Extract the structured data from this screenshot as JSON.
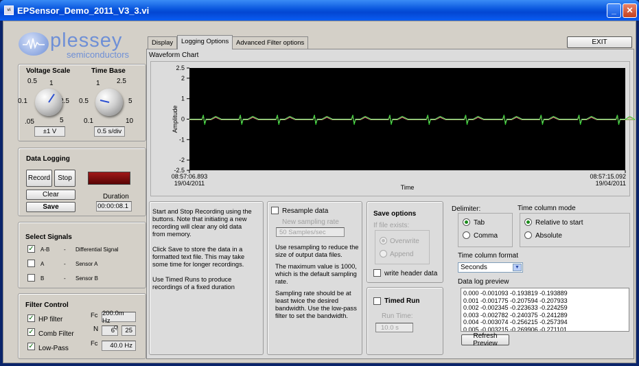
{
  "window": {
    "title": "EPSensor_Demo_2011_V3_3.vi",
    "min": "_",
    "max": "□",
    "close": "✕"
  },
  "logo": {
    "name": "plessey",
    "sub": "semiconductors"
  },
  "voltage": {
    "title": "Voltage Scale",
    "t1": "0.5",
    "t2": "1",
    "l1": "0.1",
    "r1": "2.5",
    "l2": ".05",
    "r2": "5",
    "value": "±1 V"
  },
  "time": {
    "title": "Time Base",
    "t1": "1",
    "t2": "2.5",
    "l1": "0.5",
    "r1": "5",
    "l2": "0.1",
    "r2": "10",
    "value": "0.5 s/div"
  },
  "logging": {
    "title": "Data Logging",
    "record": "Record",
    "stop": "Stop",
    "clear": "Clear",
    "save": "Save",
    "duration_label": "Duration",
    "duration": "00:00:08.1",
    "led_color": "#7a0a0a"
  },
  "signals": {
    "title": "Select Signals",
    "items": [
      {
        "code": "A-B",
        "dash": "-",
        "desc": "Differential Signal",
        "checked": "✓"
      },
      {
        "code": "A",
        "dash": "-",
        "desc": "Sensor A",
        "checked": ""
      },
      {
        "code": "B",
        "dash": "-",
        "desc": "Sensor B",
        "checked": ""
      }
    ]
  },
  "filter": {
    "title": "Filter Control",
    "hp": "HP filter",
    "hp_fc_label": "Fc",
    "hp_fc": "200.0m Hz",
    "comb": "Comb Filter",
    "n_label": "N",
    "n": "6",
    "q_label": "Q",
    "q": "25",
    "lp": "Low-Pass",
    "lp_fc_label": "Fc",
    "lp_fc": "40.0 Hz"
  },
  "tabs": [
    "Display",
    "Logging Options",
    "Advanced Filter options"
  ],
  "exit": "EXIT",
  "chart": {
    "title": "Waveform Chart",
    "ylabel": "Amplitude",
    "xlabel": "Time",
    "yticks": [
      "2.5",
      "2",
      "1",
      "0",
      "-1",
      "-2",
      "-2.5"
    ],
    "x_start_time": "08:57:06.893",
    "x_start_date": "19/04/2011",
    "x_end_time": "08:57:15.092",
    "x_end_date": "19/04/2011",
    "beats": [
      0.035,
      0.12,
      0.205,
      0.29,
      0.378,
      0.463,
      0.55,
      0.637,
      0.725,
      0.81,
      0.897,
      0.985
    ]
  },
  "help": {
    "p1": "Start and Stop Recording using the buttons. Note that initiating a new recording will clear any old data from memory.",
    "p2": "Click Save to store the data in a formatted text file. This may take some time for longer recordings.",
    "p3": "Use Timed Runs to produce recordings of a fixed duration"
  },
  "resample": {
    "label": "Resample data",
    "rate_label": "New sampling rate",
    "rate": "50 Samples/sec",
    "p1": "Use resampling to reduce the size of output data files.",
    "p2": "The maximum value is 1000, which is the default sampling rate.",
    "p3": "Sampling rate should be at least twice the desired bandwidth. Use the low-pass filter to set the bandwidth."
  },
  "save_options": {
    "title": "Save options",
    "if_exists": "If file exists:",
    "overwrite": "Overwrite",
    "append": "Append",
    "header": "write header data"
  },
  "timed": {
    "label": "Timed Run",
    "run_time_label": "Run Time:",
    "run_time": "10.0 s"
  },
  "delimiter": {
    "title": "Delimiter:",
    "tab": "Tab",
    "comma": "Comma"
  },
  "time_mode": {
    "title": "Time column mode",
    "relative": "Relative to start",
    "absolute": "Absolute"
  },
  "time_format": {
    "title": "Time column format",
    "value": "Seconds"
  },
  "preview": {
    "title": "Data log preview",
    "lines": [
      "0.000 -0.001093 -0.193819 -0.193889",
      "0.001 -0.001775 -0.207594 -0.207933",
      "0.002 -0.002345 -0.223633 -0.224259",
      "0.003 -0.002782 -0.240375 -0.241289",
      "0.004 -0.003074 -0.256215 -0.257394",
      "0.005 -0.003215 -0.269906 -0.271101"
    ],
    "refresh": "Refresh Preview"
  }
}
